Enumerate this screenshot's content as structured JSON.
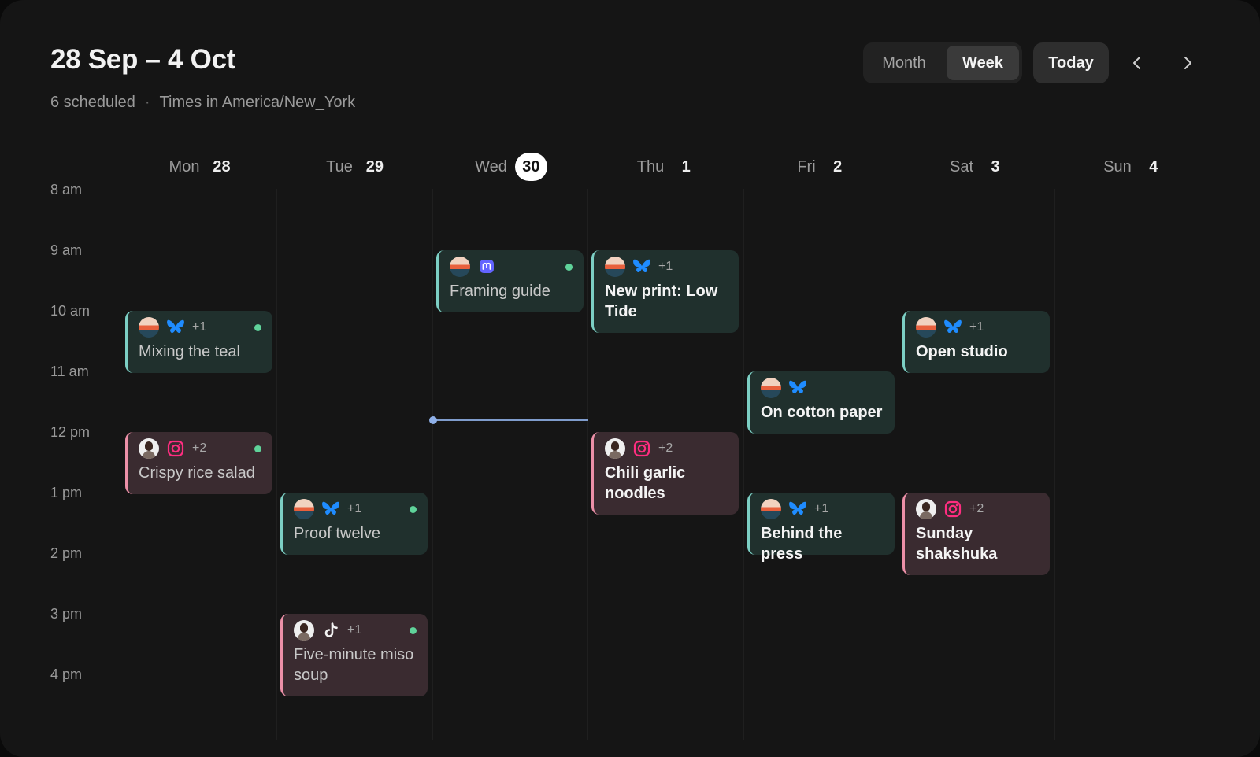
{
  "header": {
    "title": "28 Sep – 4 Oct",
    "scheduled": "6 scheduled",
    "separator": "·",
    "timezone": "Times in America/New_York"
  },
  "view_toggle": {
    "month": "Month",
    "week": "Week",
    "selected": "Week"
  },
  "today_label": "Today",
  "nav": {
    "prev_icon": "chevron-left-icon",
    "next_icon": "chevron-right-icon"
  },
  "days": [
    {
      "name": "Mon",
      "date": "28"
    },
    {
      "name": "Tue",
      "date": "29"
    },
    {
      "name": "Wed",
      "date": "30",
      "current": true
    },
    {
      "name": "Thu",
      "date": "1"
    },
    {
      "name": "Fri",
      "date": "2"
    },
    {
      "name": "Sat",
      "date": "3"
    },
    {
      "name": "Sun",
      "date": "4"
    }
  ],
  "hours": [
    "8 am",
    "9 am",
    "10 am",
    "11 am",
    "12 pm",
    "1 pm",
    "2 pm",
    "3 pm",
    "4 pm"
  ],
  "colors": {
    "teal_accent": "#7ccfc4",
    "pink_accent": "#ec90a8",
    "bluesky": "#1f8cff",
    "instagram": "#ff2d80",
    "mastodon": "#6364ff",
    "status_dot": "#5fd39a",
    "now_line": "#7f9ccc"
  },
  "events": [
    {
      "title": "Mixing the teal",
      "day": "Mon",
      "start": "10 am",
      "end": "11 am",
      "tone": "teal",
      "avatar": "sunset-avatar",
      "network": "bluesky-icon",
      "extra": "+1",
      "status_dot": true,
      "title_style": "muted"
    },
    {
      "title": "Crispy rice salad",
      "day": "Mon",
      "start": "12 pm",
      "end": "1 pm",
      "tone": "pink",
      "avatar": "person-avatar",
      "network": "instagram-icon",
      "extra": "+2",
      "status_dot": true,
      "title_style": "muted"
    },
    {
      "title": "Proof twelve",
      "day": "Tue",
      "start": "1 pm",
      "end": "2 pm",
      "tone": "teal",
      "avatar": "sunset-avatar",
      "network": "bluesky-icon",
      "extra": "+1",
      "status_dot": true,
      "title_style": "muted"
    },
    {
      "title": "Five-minute miso soup",
      "day": "Tue",
      "start": "3 pm",
      "end": "4:20 pm",
      "tone": "pink",
      "avatar": "person-avatar",
      "network": "tiktok-icon",
      "extra": "+1",
      "status_dot": true,
      "title_style": "muted"
    },
    {
      "title": "Framing guide",
      "day": "Wed",
      "start": "9 am",
      "end": "10 am",
      "tone": "teal",
      "avatar": "sunset-avatar",
      "network": "mastodon-icon",
      "extra": "",
      "status_dot": true,
      "title_style": "muted"
    },
    {
      "title": "New print: Low Tide",
      "day": "Thu",
      "start": "9 am",
      "end": "10:20 am",
      "tone": "teal",
      "avatar": "sunset-avatar",
      "network": "bluesky-icon",
      "extra": "+1",
      "status_dot": false,
      "title_style": "bright"
    },
    {
      "title": "Chili garlic noodles",
      "day": "Thu",
      "start": "12 pm",
      "end": "1:20 pm",
      "tone": "pink",
      "avatar": "person-avatar",
      "network": "instagram-icon",
      "extra": "+2",
      "status_dot": false,
      "title_style": "bright"
    },
    {
      "title": "On cotton paper",
      "day": "Fri",
      "start": "11 am",
      "end": "12 pm",
      "tone": "teal",
      "avatar": "sunset-avatar",
      "network": "bluesky-icon",
      "extra": "",
      "status_dot": false,
      "title_style": "bright"
    },
    {
      "title": "Behind the press",
      "day": "Fri",
      "start": "1 pm",
      "end": "2 pm",
      "tone": "teal",
      "avatar": "sunset-avatar",
      "network": "bluesky-icon",
      "extra": "+1",
      "status_dot": false,
      "title_style": "bright"
    },
    {
      "title": "Open studio",
      "day": "Sat",
      "start": "10 am",
      "end": "11 am",
      "tone": "teal",
      "avatar": "sunset-avatar",
      "network": "bluesky-icon",
      "extra": "+1",
      "status_dot": false,
      "title_style": "bright"
    },
    {
      "title": "Sunday shakshuka",
      "day": "Sat",
      "start": "1 pm",
      "end": "2:20 pm",
      "tone": "pink",
      "avatar": "person-avatar",
      "network": "instagram-icon",
      "extra": "+2",
      "status_dot": false,
      "title_style": "bright"
    }
  ],
  "current_time": {
    "day": "Wed",
    "time": "11:47 am"
  }
}
